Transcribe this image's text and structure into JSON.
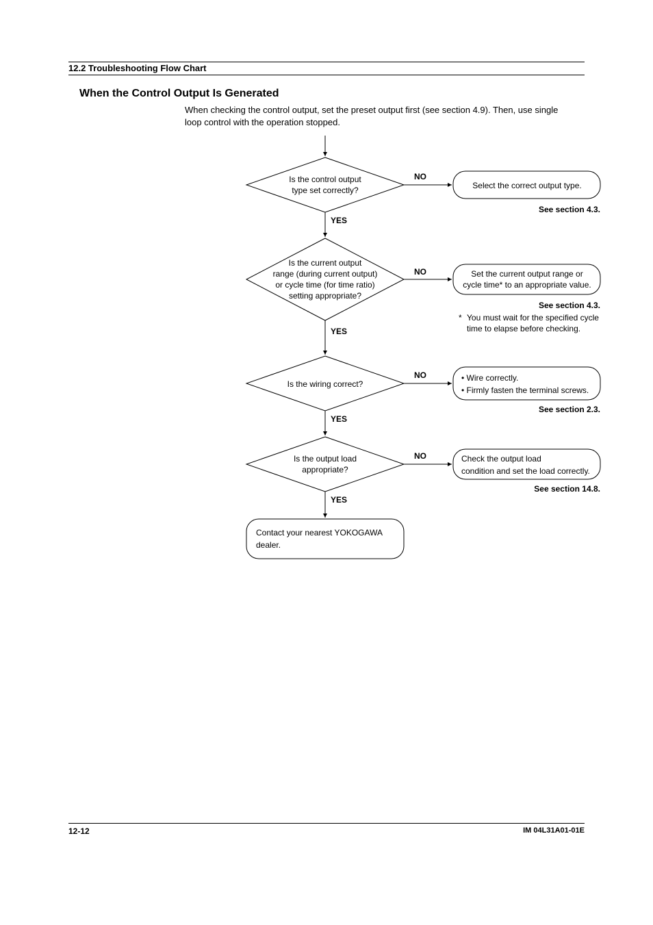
{
  "header": {
    "section": "12.2  Troubleshooting Flow Chart"
  },
  "subtitle": "When the Control Output Is Generated",
  "intro": "When checking the control output, set the preset output first (see section 4.9).  Then, use single loop control with the operation stopped.",
  "flow": {
    "d1_l1": "Is the control output",
    "d1_l2": "type set correctly?",
    "a1": "Select the correct output type.",
    "a1_ref": "See section 4.3.",
    "d2_l1": "Is the current output",
    "d2_l2": "range (during current output)",
    "d2_l3": "or cycle time (for time ratio)",
    "d2_l4": "setting appropriate?",
    "a2_l1": "Set the current output range or",
    "a2_l2": "cycle time* to an appropriate value.",
    "a2_ref": "See section 4.3.",
    "a2_note_l1": "You must wait for the specified cycle",
    "a2_note_l2": "time to elapse before checking.",
    "a2_star": "*",
    "d3": "Is the wiring correct?",
    "a3_l1": "• Wire correctly.",
    "a3_l2": "• Firmly fasten the terminal screws.",
    "a3_ref": "See section 2.3.",
    "d4_l1": "Is the output load",
    "d4_l2": "appropriate?",
    "a4_l1": "Check the output load",
    "a4_l2": "condition and set the load correctly.",
    "a4_ref": "See section 14.8.",
    "term_l1": "Contact your nearest YOKOGAWA",
    "term_l2": "dealer.",
    "yes": "YES",
    "no": "NO"
  },
  "footer": {
    "page": "12-12",
    "im": "IM 04L31A01-01E"
  }
}
